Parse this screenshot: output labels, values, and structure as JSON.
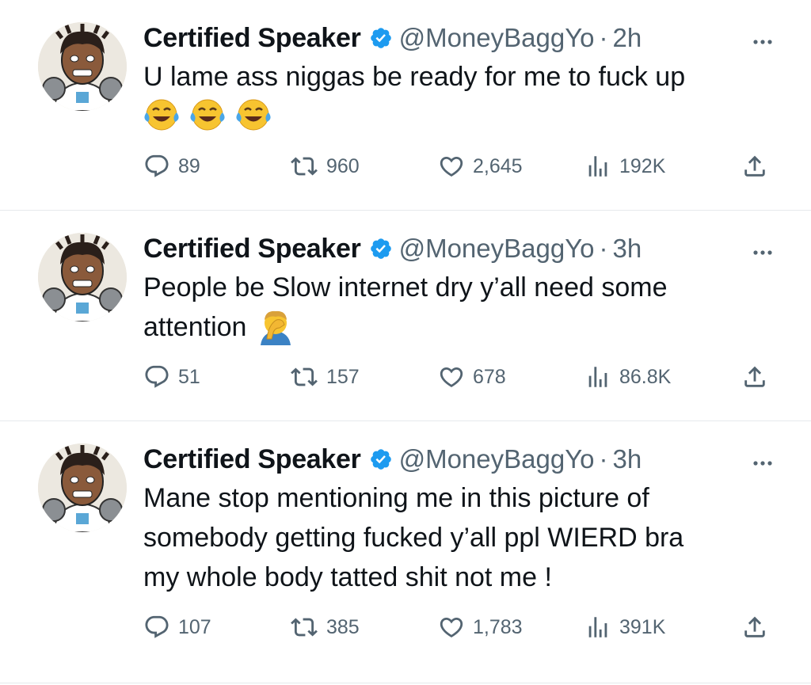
{
  "colors": {
    "verified": "#1d9bf0",
    "secondary": "#536471",
    "divider": "#e6e9ec"
  },
  "tweets": [
    {
      "name": "Certified Speaker",
      "handle": "@MoneyBaggYo",
      "separator": "·",
      "time": "2h",
      "text": "U lame ass niggas be ready for me to fuck up",
      "emojis": [
        "face-with-tears-of-joy",
        "face-with-tears-of-joy",
        "face-with-tears-of-joy"
      ],
      "replies": "89",
      "retweets": "960",
      "likes": "2,645",
      "views": "192K"
    },
    {
      "name": "Certified Speaker",
      "handle": "@MoneyBaggYo",
      "separator": "·",
      "time": "3h",
      "text_line1": "People be Slow internet dry y’all need some",
      "text_line2": "attention",
      "emojis": [
        "person-facepalming"
      ],
      "replies": "51",
      "retweets": "157",
      "likes": "678",
      "views": "86.8K"
    },
    {
      "name": "Certified Speaker",
      "handle": "@MoneyBaggYo",
      "separator": "·",
      "time": "3h",
      "text_line1": "Mane stop mentioning me in this picture of",
      "text_line2": "somebody getting fucked y’all ppl WIERD bra",
      "text_line3": "my whole body tatted shit not me !",
      "replies": "107",
      "retweets": "385",
      "likes": "1,783",
      "views": "391K"
    }
  ]
}
